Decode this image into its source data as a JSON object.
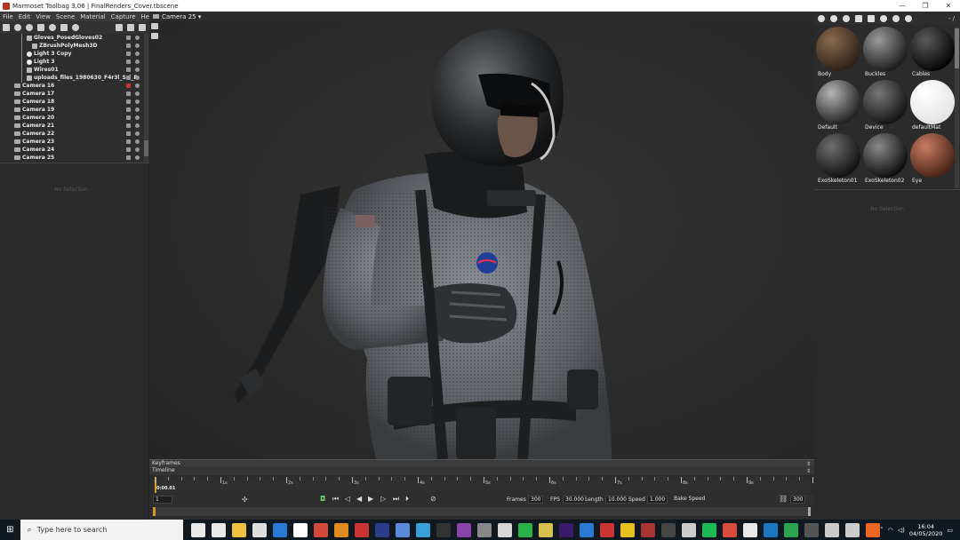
{
  "window": {
    "title": "Marmoset Toolbag 3.06  |  FinalRenders_Cover.tbscene",
    "min": "—",
    "max": "❐",
    "close": "✕"
  },
  "menu": [
    "File",
    "Edit",
    "View",
    "Scene",
    "Material",
    "Capture",
    "Help"
  ],
  "viewport": {
    "camera_label": "Camera 25 ▾"
  },
  "tree": {
    "items": [
      {
        "label": "Gloves_PosedGloves02",
        "icon": "mesh-icon",
        "indent": 30
      },
      {
        "label": "ZBrushPolyMesh3D",
        "icon": "mesh-icon",
        "indent": 36
      },
      {
        "label": "Light 3 Copy",
        "icon": "bulb-icon",
        "indent": 30
      },
      {
        "label": "Light 3",
        "icon": "bulb-icon",
        "indent": 30
      },
      {
        "label": "Wires01",
        "icon": "mesh-icon",
        "indent": 30
      },
      {
        "label": "uploads_files_1980630_F4r3l_Sci_F",
        "icon": "mesh-icon",
        "indent": 30
      },
      {
        "label": "Camera 16",
        "icon": "camera-icon",
        "indent": 16,
        "locked": true
      },
      {
        "label": "Camera 17",
        "icon": "camera-icon",
        "indent": 16
      },
      {
        "label": "Camera 18",
        "icon": "camera-icon",
        "indent": 16
      },
      {
        "label": "Camera 19",
        "icon": "camera-icon",
        "indent": 16
      },
      {
        "label": "Camera 20",
        "icon": "camera-icon",
        "indent": 16
      },
      {
        "label": "Camera 21",
        "icon": "camera-icon",
        "indent": 16
      },
      {
        "label": "Camera 22",
        "icon": "camera-icon",
        "indent": 16
      },
      {
        "label": "Camera 23",
        "icon": "camera-icon",
        "indent": 16
      },
      {
        "label": "Camera 24",
        "icon": "camera-icon",
        "indent": 16
      },
      {
        "label": "Camera 25",
        "icon": "camera-icon",
        "indent": 16
      }
    ]
  },
  "left_props": {
    "empty": "No Selection"
  },
  "materials": {
    "selector": "- / ",
    "items": [
      {
        "name": "Body",
        "c1": "#8a6a4e",
        "c2": "#2e2218"
      },
      {
        "name": "Buckles",
        "c1": "#9a9a9a",
        "c2": "#1e1e1e"
      },
      {
        "name": "Cables",
        "c1": "#5a5a5a",
        "c2": "#050505"
      },
      {
        "name": "Default",
        "c1": "#b5b5b5",
        "c2": "#222222"
      },
      {
        "name": "Device",
        "c1": "#777777",
        "c2": "#151515"
      },
      {
        "name": "defaultMat",
        "c1": "#ffffff",
        "c2": "#e4e4e4"
      },
      {
        "name": "ExoSkeleton01",
        "c1": "#6e6e6e",
        "c2": "#121212"
      },
      {
        "name": "ExoSkeleton02",
        "c1": "#8a8a8a",
        "c2": "#0e0e0e"
      },
      {
        "name": "Eye",
        "c1": "#c97c62",
        "c2": "#4a2418"
      }
    ]
  },
  "right_props": {
    "empty": "No Selection"
  },
  "timeline": {
    "keyframes_label": "Keyframes",
    "timeline_label": "Timeline",
    "current_time": "0:00.01",
    "ticks": [
      "1s",
      "2s",
      "3s",
      "4s",
      "5s",
      "6s",
      "7s",
      "8s",
      "9s"
    ],
    "frame_field": "1",
    "frames_label": "Frames",
    "frames": "300",
    "fps_label": "FPS",
    "fps": "30.000",
    "length_label": "Length",
    "length": "10.000",
    "speed_label": "Speed",
    "speed": "1.000",
    "bake_label": "Bake Speed",
    "end_frame": "300"
  },
  "taskbar": {
    "search_placeholder": "Type here to search",
    "time": "16:04",
    "date": "04/05/2020",
    "apps": [
      "#e8e8e8",
      "#e8e8e8",
      "#f0c040",
      "#dddddd",
      "#2a7ad5",
      "#ffffff",
      "#d44a3a",
      "#e08a20",
      "#cc3333",
      "#2b3c8c",
      "#5a8ad8",
      "#3aa0d8",
      "#333333",
      "#8844aa",
      "#888888",
      "#d8d8d8",
      "#2bb14a",
      "#d8c050",
      "#3a1a6a",
      "#2a7ad5",
      "#cc3333",
      "#e8c020",
      "#aa3333",
      "#444444",
      "#cccccc",
      "#1db954",
      "#d84a3a",
      "#e8e8e8",
      "#1a78c2",
      "#2da44e",
      "#555555",
      "#cccccc",
      "#cccccc",
      "#ee6622"
    ]
  }
}
